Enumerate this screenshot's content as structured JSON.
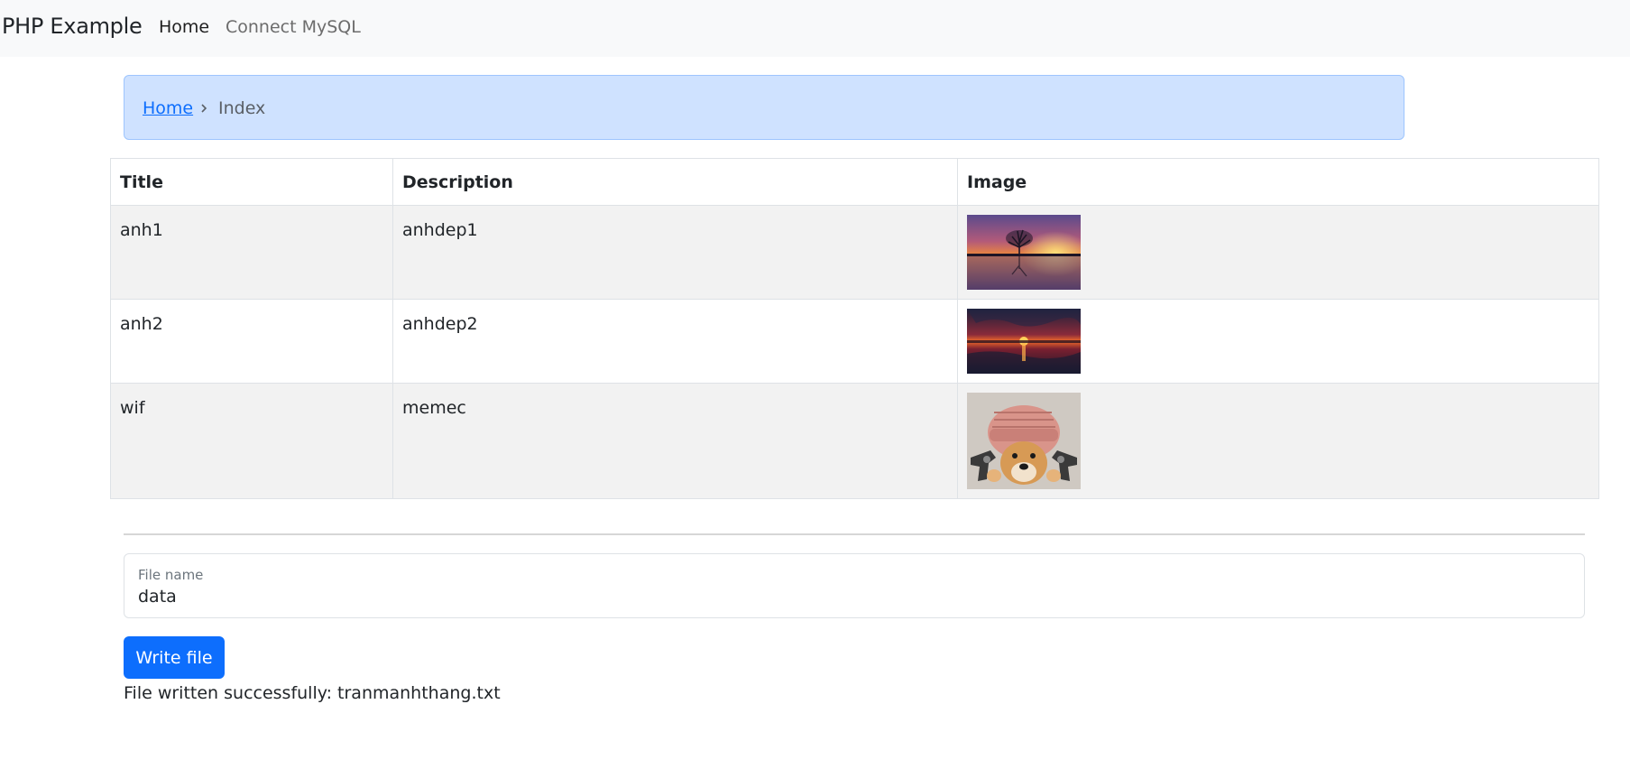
{
  "navbar": {
    "brand": "PHP Example",
    "links": [
      {
        "label": "Home",
        "active": true
      },
      {
        "label": "Connect MySQL",
        "active": false
      }
    ]
  },
  "breadcrumb": {
    "home_label": "Home",
    "current_label": "Index",
    "separator_icon": "chevron-right-icon"
  },
  "table": {
    "headers": [
      "Title",
      "Description",
      "Image"
    ],
    "rows": [
      {
        "title": "anh1",
        "description": "anhdep1",
        "image": "sunset-tree-reflection"
      },
      {
        "title": "anh2",
        "description": "anhdep2",
        "image": "sunset-over-water"
      },
      {
        "title": "wif",
        "description": "memec",
        "image": "dog-in-pink-hat"
      }
    ]
  },
  "form": {
    "file_name_label": "File name",
    "file_name_value": "data",
    "submit_label": "Write file"
  },
  "status_message": "File written successfully: tranmanhthang.txt",
  "colors": {
    "primary": "#0d6efd",
    "breadcrumb_bg": "#cfe2ff",
    "navbar_bg": "#f8f9fa",
    "striped_row_bg": "#f2f2f2"
  }
}
